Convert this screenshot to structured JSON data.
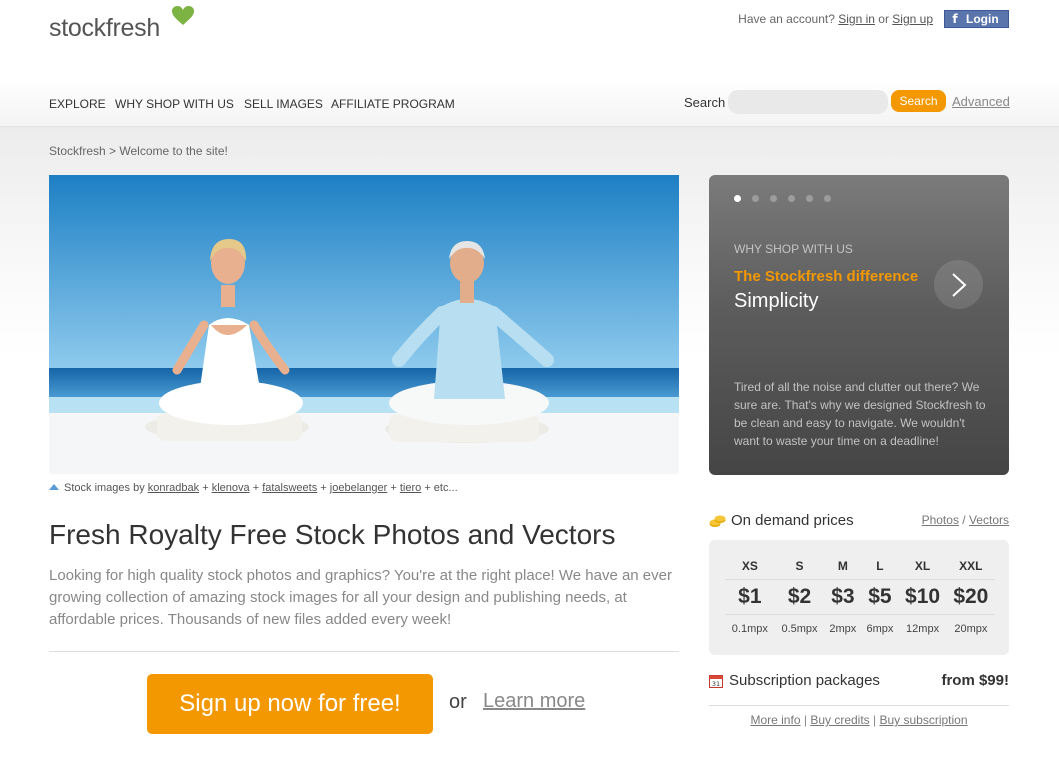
{
  "logo": {
    "text": "stockfresh"
  },
  "account": {
    "prompt": "Have an account?",
    "sign_in": "Sign in",
    "or": "or",
    "sign_up": "Sign up",
    "fb_login": "Login"
  },
  "nav": {
    "items": [
      "EXPLORE",
      "WHY SHOP WITH US",
      "SELL IMAGES",
      "AFFILIATE PROGRAM"
    ]
  },
  "search": {
    "label": "Search",
    "placeholder": "",
    "button": "Search",
    "advanced": "Advanced"
  },
  "breadcrumb": {
    "text": "Stockfresh > Welcome to the site!"
  },
  "hero_caption": {
    "prefix": "Stock images by",
    "authors": [
      "konradbak",
      "klenova",
      "fatalsweets",
      "joebelanger",
      "tiero"
    ],
    "sep": "+",
    "suffix": "+ etc..."
  },
  "main": {
    "heading": "Fresh Royalty Free Stock Photos and Vectors",
    "intro": "Looking for high quality stock photos and graphics? You're at the right place! We have an ever growing collection of amazing stock images for all your design and publishing needs, at affordable prices. Thousands of new files added every week!",
    "signup_button": "Sign up now for free!",
    "or": "or",
    "learn_more": "Learn more"
  },
  "promo": {
    "slide_count": 6,
    "active_slide": 1,
    "kicker": "WHY SHOP WITH US",
    "title": "The Stockfresh difference",
    "subtitle": "Simplicity",
    "text": "Tired of all the noise and clutter out there? We sure are. That's why we designed Stockfresh to be clean and easy to navigate. We wouldn't want to waste your time on a deadline!"
  },
  "pricing": {
    "heading": "On demand prices",
    "photos_link": "Photos",
    "slash": "/",
    "vectors_link": "Vectors",
    "sizes": [
      "XS",
      "S",
      "M",
      "L",
      "XL",
      "XXL"
    ],
    "prices": [
      "$1",
      "$2",
      "$3",
      "$5",
      "$10",
      "$20"
    ],
    "megapixels": [
      "0.1mpx",
      "0.5mpx",
      "2mpx",
      "6mpx",
      "12mpx",
      "20mpx"
    ]
  },
  "subscription": {
    "label": "Subscription packages",
    "price": "from $99!",
    "calendar_day": "31"
  },
  "footer_links": {
    "more_info": "More info",
    "buy_credits": "Buy credits",
    "buy_subscription": "Buy subscription",
    "sep": "|"
  },
  "colors": {
    "accent": "#f39800",
    "facebook": "#3b5998",
    "logo_heart": "#7cb342"
  }
}
